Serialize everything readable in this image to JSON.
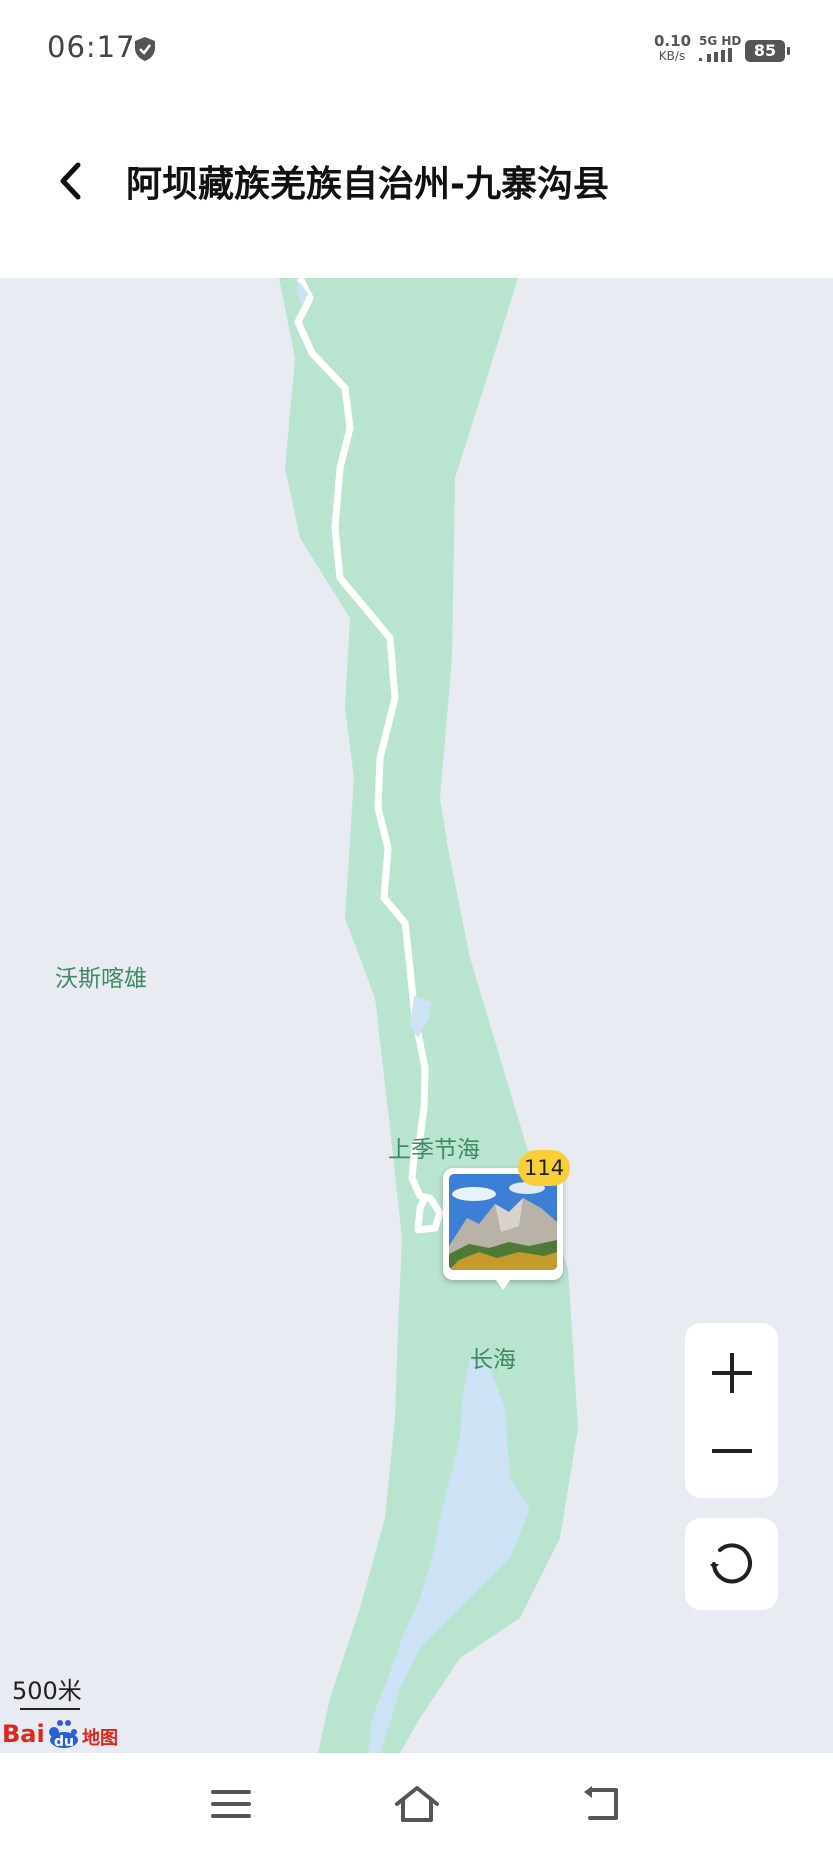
{
  "status_bar": {
    "time": "06:17",
    "net_speed_value": "0.10",
    "net_speed_unit": "KB/s",
    "network_label": "5G HD",
    "battery": "85"
  },
  "header": {
    "title": "阿坝藏族羌族自治州-九寨沟县"
  },
  "map": {
    "labels": {
      "wosikaxiong": "沃斯喀雄",
      "shangjihaizi": "上季节海",
      "changhai": "长海"
    },
    "photo_marker": {
      "count": "114"
    },
    "scale": "500米",
    "logo_text": "Baidu 地图",
    "colors": {
      "background": "#e8ebf1",
      "valley_green": "#b9e4cf",
      "water": "#cde3f5",
      "label_green": "#3f8a64",
      "badge_yellow": "#f8cf37"
    }
  },
  "icons": {
    "back": "chevron-left-icon",
    "zoom_in": "plus-icon",
    "zoom_out": "minus-icon",
    "reset": "refresh-icon",
    "menu": "menu-icon",
    "home": "home-icon",
    "back_nav": "return-icon"
  }
}
